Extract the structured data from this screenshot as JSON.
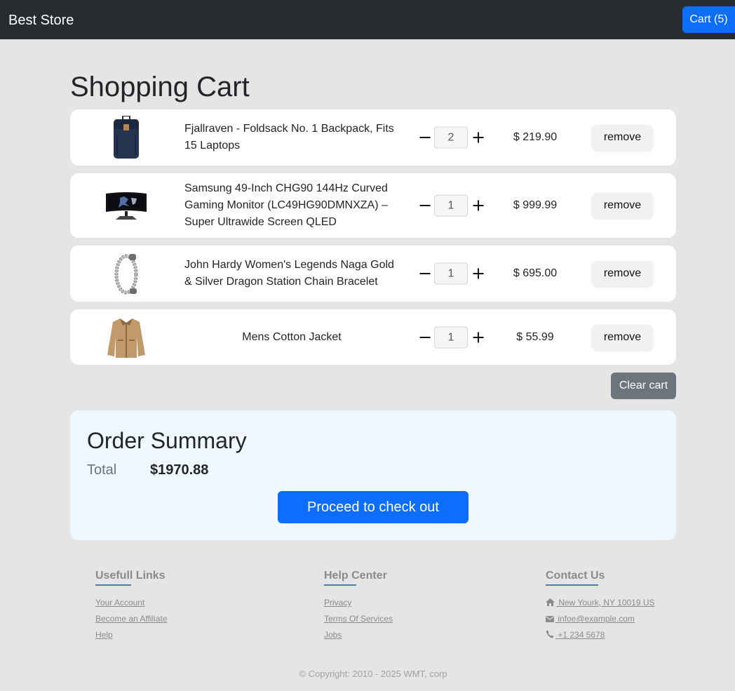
{
  "navbar": {
    "brand": "Best Store",
    "cart_button": "Cart (5)"
  },
  "page_title": "Shopping Cart",
  "cart": {
    "items": [
      {
        "name": "Fjallraven - Foldsack No. 1 Backpack, Fits 15 Laptops",
        "quantity": "2",
        "price": "$ 219.90",
        "remove_label": "remove",
        "image_icon": "backpack-image"
      },
      {
        "name": "Samsung 49-Inch CHG90 144Hz Curved Gaming Monitor (LC49HG90DMNXZA) – Super Ultrawide Screen QLED",
        "quantity": "1",
        "price": "$ 999.99",
        "remove_label": "remove",
        "image_icon": "monitor-image"
      },
      {
        "name": "John Hardy Women's Legends Naga Gold & Silver Dragon Station Chain Bracelet",
        "quantity": "1",
        "price": "$ 695.00",
        "remove_label": "remove",
        "image_icon": "bracelet-image"
      },
      {
        "name": "Mens Cotton Jacket",
        "quantity": "1",
        "price": "$ 55.99",
        "remove_label": "remove",
        "image_icon": "jacket-image"
      }
    ],
    "minus_symbol": "−",
    "plus_symbol": "+",
    "clear_label": "Clear cart"
  },
  "summary": {
    "title": "Order Summary",
    "total_label": "Total",
    "total_value": "$1970.88",
    "checkout_label": "Proceed to check out"
  },
  "footer": {
    "useful": {
      "title": "Usefull Links",
      "links": [
        "Your Account",
        "Become an Affiliate",
        "Help"
      ]
    },
    "help": {
      "title": "Help Center",
      "links": [
        "Privacy",
        "Terms Of Services",
        "Jobs"
      ]
    },
    "contact": {
      "title": "Contact Us",
      "address": " New Yourk, NY 10019 US",
      "email": " infoe@example.com",
      "phone": " +1 234 5678"
    },
    "copyright": "© Copyright: 2010 - 2025 WMT, corp"
  },
  "colors": {
    "navbar_bg": "#282c31",
    "primary": "#0d6efd",
    "secondary": "#6c757d",
    "summary_bg": "#f0f8ff",
    "page_bg": "#e5e5e5"
  }
}
